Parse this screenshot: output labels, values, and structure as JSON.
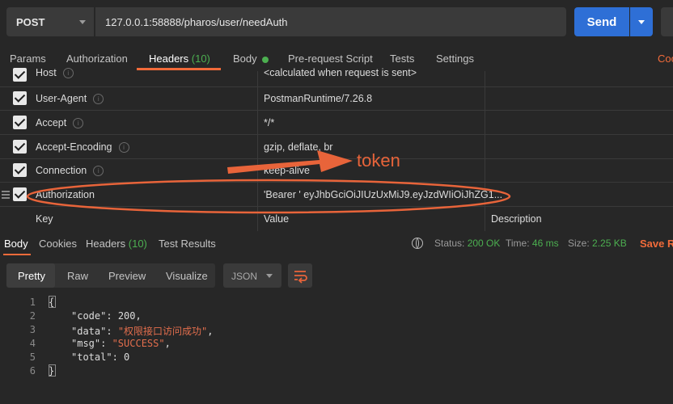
{
  "request": {
    "method": "POST",
    "url": "127.0.0.1:58888/pharos/user/needAuth",
    "send_label": "Send"
  },
  "tabs": {
    "params": "Params",
    "authorization": "Authorization",
    "headers": "Headers",
    "headers_count": "(10)",
    "body": "Body",
    "prerequest": "Pre-request Script",
    "tests": "Tests",
    "settings": "Settings",
    "cookies_partial": "Coo"
  },
  "headers": [
    {
      "key": "Host",
      "value": "<calculated when request is sent>"
    },
    {
      "key": "User-Agent",
      "value": "PostmanRuntime/7.26.8"
    },
    {
      "key": "Accept",
      "value": "*/*"
    },
    {
      "key": "Accept-Encoding",
      "value": "gzip, deflate, br"
    },
    {
      "key": "Connection",
      "value": "keep-alive"
    },
    {
      "key": "Authorization",
      "value": "'Bearer ' eyJhbGciOiJIUzUxMiJ9.eyJzdWIiOiJhZG1..."
    }
  ],
  "new_row": {
    "key": "Key",
    "value": "Value",
    "description": "Description"
  },
  "response_tabs": {
    "body": "Body",
    "cookies": "Cookies",
    "headers": "Headers",
    "headers_count": "(10)",
    "test_results": "Test Results"
  },
  "response_meta": {
    "status_label": "Status:",
    "status_value": "200 OK",
    "time_label": "Time:",
    "time_value": "46 ms",
    "size_label": "Size:",
    "size_value": "2.25 KB",
    "save_label": "Save Re"
  },
  "view_modes": [
    "Pretty",
    "Raw",
    "Preview",
    "Visualize"
  ],
  "format_select": "JSON",
  "code_lines": [
    "1",
    "2",
    "3",
    "4",
    "5",
    "6"
  ],
  "response_body": {
    "open": "{",
    "code_key": "\"code\"",
    "code_val": "200",
    "data_key": "\"data\"",
    "data_val": "\"权限接口访问成功\"",
    "msg_key": "\"msg\"",
    "msg_val": "\"SUCCESS\"",
    "total_key": "\"total\"",
    "total_val": "0",
    "close": "}"
  },
  "annotation": {
    "label": "token",
    "color": "#e8643a"
  }
}
